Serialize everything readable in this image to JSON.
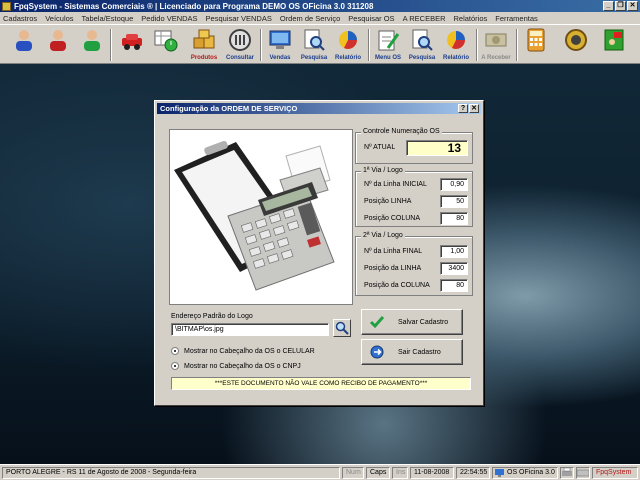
{
  "window": {
    "title": "FpqSystem - Sistemas Comerciais ®  | Licenciado para  Programa DEMO OS OFicina 3.0 311208",
    "controls": [
      "_",
      "❐",
      "✕"
    ]
  },
  "menu": [
    "Cadastros",
    "Veículos",
    "Tabela/Estoque",
    "Pedido VENDAS",
    "Pesquisar VENDAS",
    "Ordem de Serviço",
    "Pesquisar OS",
    "A RECEBER",
    "Relatórios",
    "Ferramentas"
  ],
  "toolbar": {
    "produtos": "Produtos",
    "consultar": "Consultar",
    "vendas": "Vendas",
    "pesquisa1": "Pesquisa",
    "relatorio1": "Relatório",
    "menu_os": "Menu OS",
    "pesquisa2": "Pesquisa",
    "relatorio2": "Relatório",
    "a_receber": "A Receber"
  },
  "dialog": {
    "title": "Configuração da ORDEM DE SERVIÇO",
    "help": "?",
    "close": "✕",
    "numeracao": {
      "title": "Controle Numeração OS",
      "label": "Nº ATUAL",
      "value": "13"
    },
    "via1": {
      "title": "1ª Via / Logo",
      "rows": [
        {
          "label": "Nº da Linha INICIAL",
          "value": "0,90"
        },
        {
          "label": "Posição LINHA",
          "value": "50"
        },
        {
          "label": "Posição COLUNA",
          "value": "80"
        }
      ]
    },
    "via2": {
      "title": "2ª Via / Logo",
      "rows": [
        {
          "label": "Nº da Linha FINAL",
          "value": "1,00"
        },
        {
          "label": "Posição da LINHA",
          "value": "3400"
        },
        {
          "label": "Posição da COLUNA",
          "value": "80"
        }
      ]
    },
    "salvar": "Salvar Cadastro",
    "sair": "Sair Cadastro",
    "logo_label": "Endereço Padrão do Logo",
    "logo_path": "\\BITMAP\\os.jpg",
    "radio_celular": "Mostrar no Cabeçalho da OS o CELULAR",
    "radio_cnpj": "Mostrar no Cabeçalho da OS o CNPJ",
    "notice": "***ESTE DOCUMENTO NÃO VALE COMO RECIBO DE PAGAMENTO***"
  },
  "statusbar": {
    "location": "PORTO ALEGRE - RS 11 de Agosto de 2008 - Segunda-feira",
    "num": "Num",
    "caps": "Caps",
    "ins": "Ins",
    "date": "11-08-2008",
    "time": "22:54:55",
    "version": "OS OFicina 3.0",
    "brand": "FpqSystem"
  },
  "colors": {
    "title_bar": "#0a246a",
    "face": "#d4d0c8",
    "notice_bg": "#ffffcc",
    "accent_red": "#b01818"
  }
}
